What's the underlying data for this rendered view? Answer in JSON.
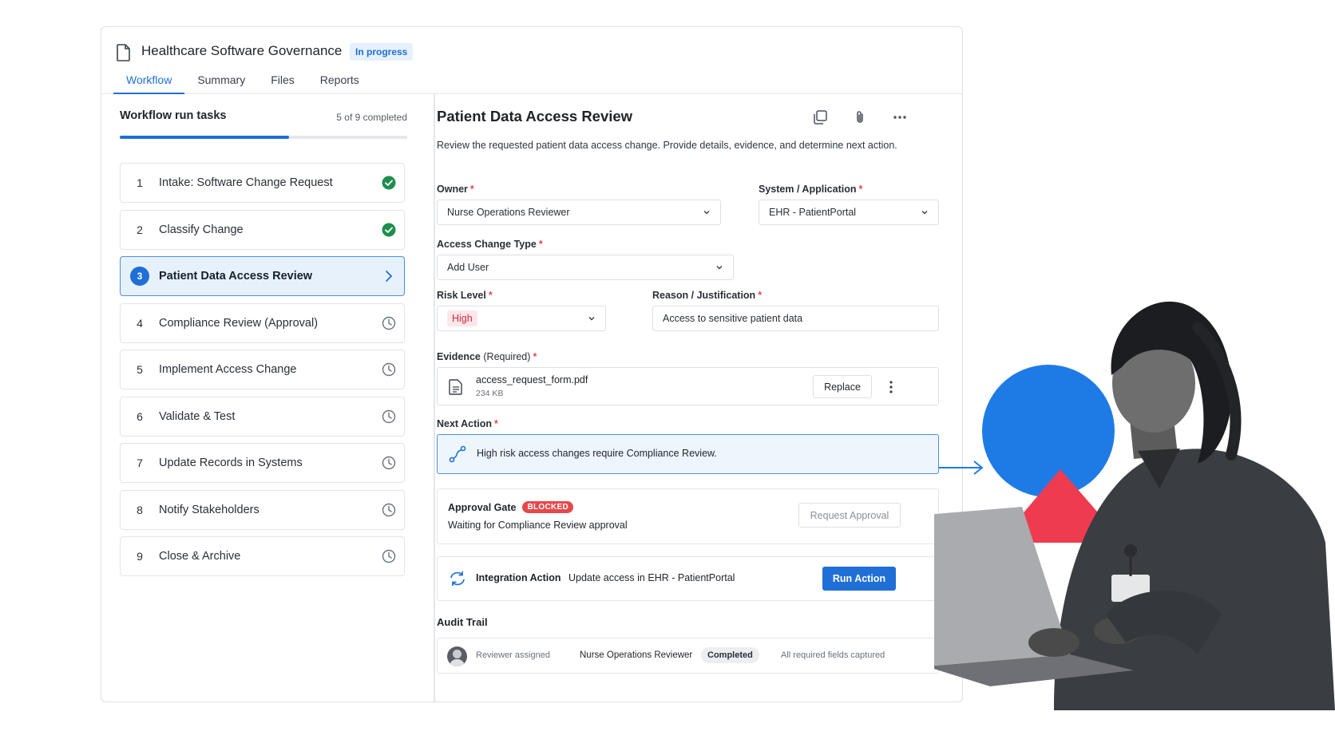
{
  "header": {
    "title": "Healthcare Software Governance",
    "status_badge": "In progress",
    "tabs": [
      "Workflow",
      "Summary",
      "Files",
      "Reports"
    ],
    "active_tab": "Workflow"
  },
  "tasks_panel": {
    "title": "Workflow run tasks",
    "count_text": "5 of 9 completed",
    "progress_fraction": 0.59,
    "tasks": [
      {
        "num": "1",
        "label": "Intake: Software Change Request",
        "status": "complete"
      },
      {
        "num": "2",
        "label": "Classify Change",
        "status": "complete"
      },
      {
        "num": "3",
        "label": "Patient Data Access Review",
        "status": "active"
      },
      {
        "num": "4",
        "label": "Compliance Review (Approval)",
        "status": "pending"
      },
      {
        "num": "5",
        "label": "Implement Access Change",
        "status": "pending"
      },
      {
        "num": "6",
        "label": "Validate & Test",
        "status": "pending"
      },
      {
        "num": "7",
        "label": "Update Records in Systems",
        "status": "pending"
      },
      {
        "num": "8",
        "label": "Notify Stakeholders",
        "status": "pending"
      },
      {
        "num": "9",
        "label": "Close & Archive",
        "status": "pending"
      }
    ]
  },
  "detail": {
    "title": "Patient Data Access Review",
    "description": "Review the requested patient data access change. Provide details, evidence, and determine next action.",
    "owner": {
      "label": "Owner",
      "value": "Nurse Operations Reviewer"
    },
    "system": {
      "label": "System / Application",
      "value": "EHR - PatientPortal"
    },
    "access_type": {
      "label": "Access Change Type",
      "value": "Add User"
    },
    "risk": {
      "label": "Risk Level",
      "value": "High"
    },
    "reason": {
      "label": "Reason / Justification",
      "value": "Access to sensitive patient data"
    },
    "evidence": {
      "label": "Evidence",
      "label_suffix": "(Required)",
      "file_name": "access_request_form.pdf",
      "file_size": "234 KB",
      "replace_label": "Replace"
    },
    "next_action": {
      "label": "Next Action",
      "message": "High risk access changes require Compliance Review."
    },
    "gate": {
      "title": "Approval Gate",
      "badge": "BLOCKED",
      "message": "Waiting for Compliance Review approval",
      "button": "Request Approval"
    },
    "integration": {
      "title": "Integration Action",
      "message": "Update access in EHR - PatientPortal",
      "button": "Run Action"
    },
    "audit": {
      "title": "Audit Trail",
      "event": "Reviewer assigned",
      "actor": "Nurse Operations Reviewer",
      "status": "Completed",
      "note": "All required fields captured"
    }
  },
  "colors": {
    "accent": "#1f6fd6",
    "success": "#1e8e4f",
    "danger": "#e5484d",
    "illus_blue": "#1e7be6",
    "illus_red": "#ef3b50"
  }
}
